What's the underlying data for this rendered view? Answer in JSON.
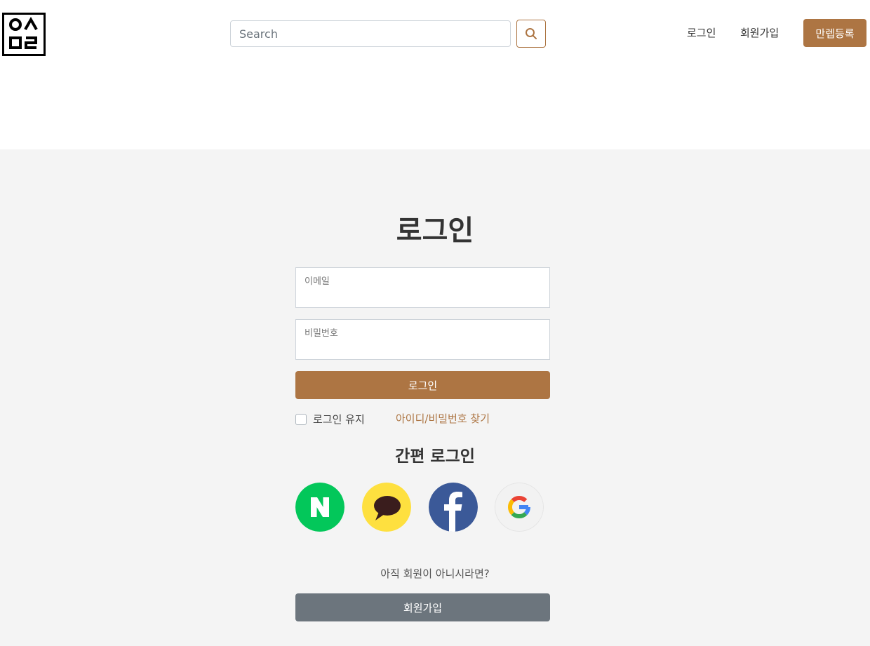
{
  "header": {
    "logo_icon": "brand-logo-icon",
    "search": {
      "placeholder": "Search",
      "value": "",
      "icon": "search-icon"
    },
    "nav": {
      "login_label": "로그인",
      "signup_label": "회원가입",
      "register_label": "만렙등록"
    }
  },
  "login": {
    "title": "로그인",
    "email": {
      "label": "이메일",
      "value": ""
    },
    "password": {
      "label": "비밀번호",
      "value": ""
    },
    "submit_label": "로그인",
    "remember_label": "로그인 유지",
    "remember_checked": false,
    "find_account_label": "아이디/비밀번호 찾기"
  },
  "sns": {
    "title": "간편 로그인",
    "providers": [
      {
        "icon": "naver-icon",
        "color": "#03c75a"
      },
      {
        "icon": "kakao-icon",
        "color": "#fee03f"
      },
      {
        "icon": "facebook-icon",
        "color": "#3b5998"
      },
      {
        "icon": "google-icon",
        "color": "#f2f2f2"
      }
    ]
  },
  "signup": {
    "prompt": "아직 회원이 아니시라면?",
    "button_label": "회원가입"
  },
  "colors": {
    "accent": "#ad7543",
    "secondary_button": "#6c757d",
    "page_background": "#f4f4f4"
  }
}
